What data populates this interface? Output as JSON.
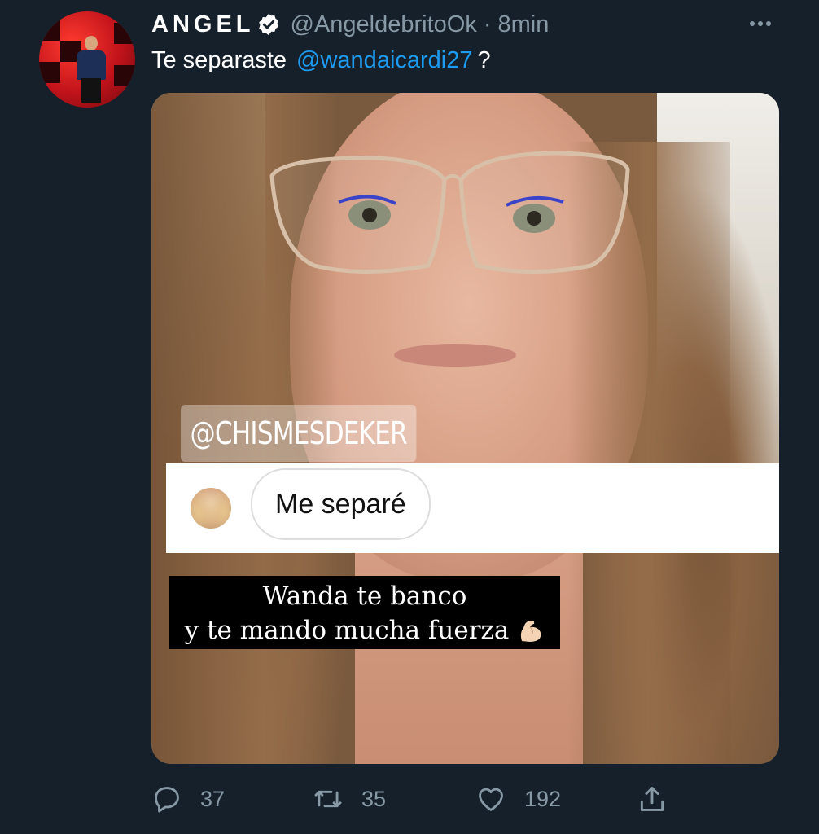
{
  "tweet": {
    "author": {
      "display_name": "ANGEL",
      "handle": "@AngeldebritoOk",
      "separator": "·",
      "time": "8min"
    },
    "text": {
      "before": "Te separaste",
      "mention": "@wandaicardi27",
      "after": "?"
    },
    "media": {
      "watermark": "@CHISMESDEKER",
      "reply_bubble": "Me separé",
      "caption_line1": "Wanda te banco",
      "caption_line2": "y te mando mucha fuerza"
    },
    "actions": {
      "replies": "37",
      "retweets": "35",
      "likes": "192"
    }
  },
  "colors": {
    "background": "#15202b",
    "secondary_text": "#8899a6",
    "link": "#1d9bf0"
  },
  "icons": [
    "verified-badge-icon",
    "more-icon",
    "reply-icon",
    "retweet-icon",
    "like-icon",
    "share-icon",
    "flexed-biceps-emoji"
  ]
}
